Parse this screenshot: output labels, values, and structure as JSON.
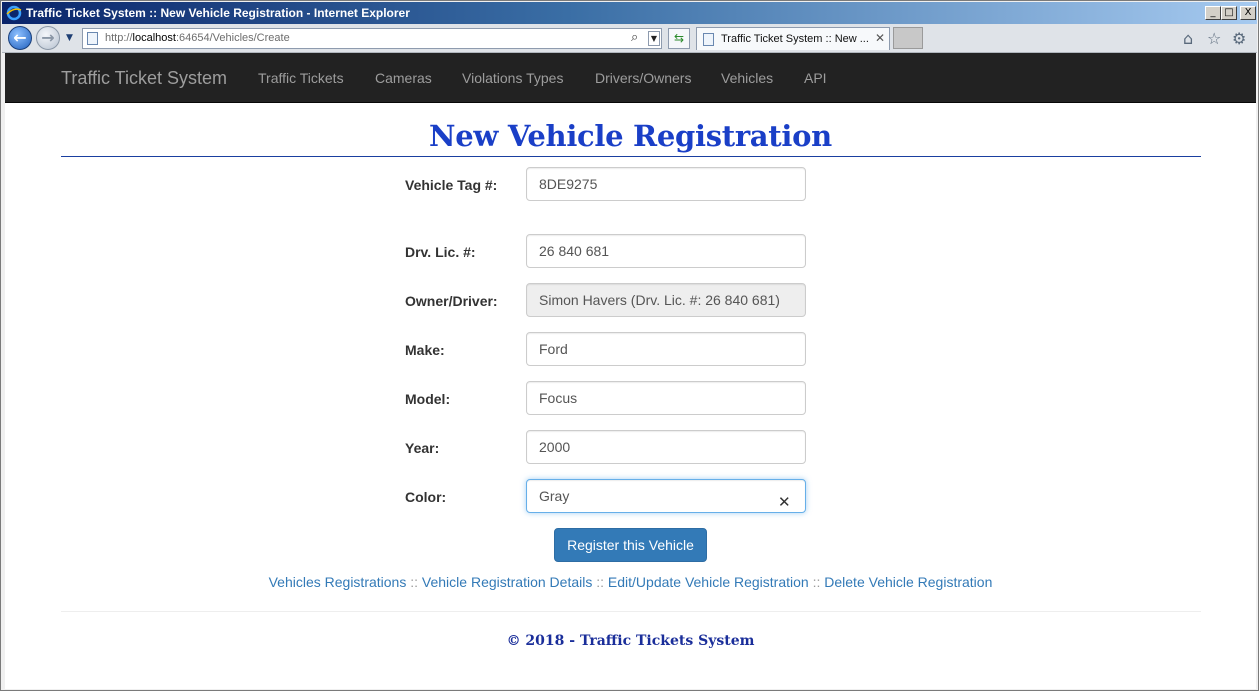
{
  "window": {
    "title": "Traffic Ticket System :: New Vehicle Registration - Internet Explorer",
    "controls": {
      "minimize": "_",
      "maximize": "□",
      "close": "X"
    }
  },
  "browser": {
    "url_prefix": "http://",
    "url_host": "localhost",
    "url_rest": ":64654/Vehicles/Create",
    "tab_label": "Traffic Ticket System :: New ...",
    "icons": [
      "back-icon",
      "forward-icon",
      "search-icon",
      "refresh-icon",
      "home-icon",
      "favorites-star-icon",
      "settings-gear-icon"
    ]
  },
  "navbar": {
    "brand": "Traffic Ticket System",
    "links": [
      "Traffic Tickets",
      "Cameras",
      "Violations Types",
      "Drivers/Owners",
      "Vehicles",
      "API"
    ]
  },
  "form": {
    "heading": "New Vehicle Registration",
    "fields": [
      {
        "label": "Vehicle Tag #:",
        "value": "8DE9275"
      },
      {
        "label": "Drv. Lic. #:",
        "value": "26 840 681"
      },
      {
        "label": "Owner/Driver:",
        "value": "Simon Havers (Drv. Lic. #: 26 840 681)"
      },
      {
        "label": "Make:",
        "value": "Ford"
      },
      {
        "label": "Model:",
        "value": "Focus"
      },
      {
        "label": "Year:",
        "value": "2000"
      },
      {
        "label": "Color:",
        "value": "Gray"
      }
    ],
    "clear_glyph": "✕",
    "submit_label": "Register this Vehicle"
  },
  "links": {
    "items": [
      "Vehicles Registrations",
      "Vehicle Registration Details",
      "Edit/Update Vehicle Registration",
      "Delete Vehicle Registration"
    ],
    "separator": "::"
  },
  "footer": {
    "text": "© 2018 - Traffic Tickets System"
  },
  "colors": {
    "heading": "#1a3fc7",
    "navbar_bg": "#222222",
    "button": "#337ab7",
    "link": "#337ab7"
  }
}
